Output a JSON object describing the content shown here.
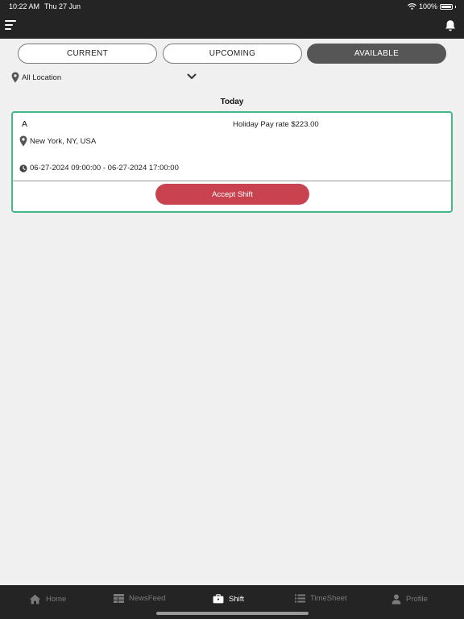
{
  "status": {
    "time": "10:22 AM",
    "date": "Thu 27 Jun",
    "battery": "100%"
  },
  "tabs": [
    {
      "label": "CURRENT",
      "active": false
    },
    {
      "label": "UPCOMING",
      "active": false
    },
    {
      "label": "AVAILABLE",
      "active": true
    }
  ],
  "filter": {
    "location_label": "All Location"
  },
  "section": {
    "title": "Today"
  },
  "shift": {
    "name": "A",
    "pay_rate": "Holiday Pay rate $223.00",
    "location": "New York, NY, USA",
    "time_range": "06-27-2024 09:00:00 - 06-27-2024 17:00:00",
    "accept_label": "Accept Shift"
  },
  "nav": {
    "items": [
      {
        "label": "Home",
        "icon": "home-icon"
      },
      {
        "label": "NewsFeed",
        "icon": "newsfeed-icon"
      },
      {
        "label": "Shift",
        "icon": "briefcase-icon",
        "active": true
      },
      {
        "label": "TimeSheet",
        "icon": "timesheet-icon"
      },
      {
        "label": "Profile",
        "icon": "profile-icon"
      }
    ]
  },
  "colors": {
    "accent_green": "#45b889",
    "accept_red": "#c8434f",
    "bar_dark": "#242424"
  }
}
